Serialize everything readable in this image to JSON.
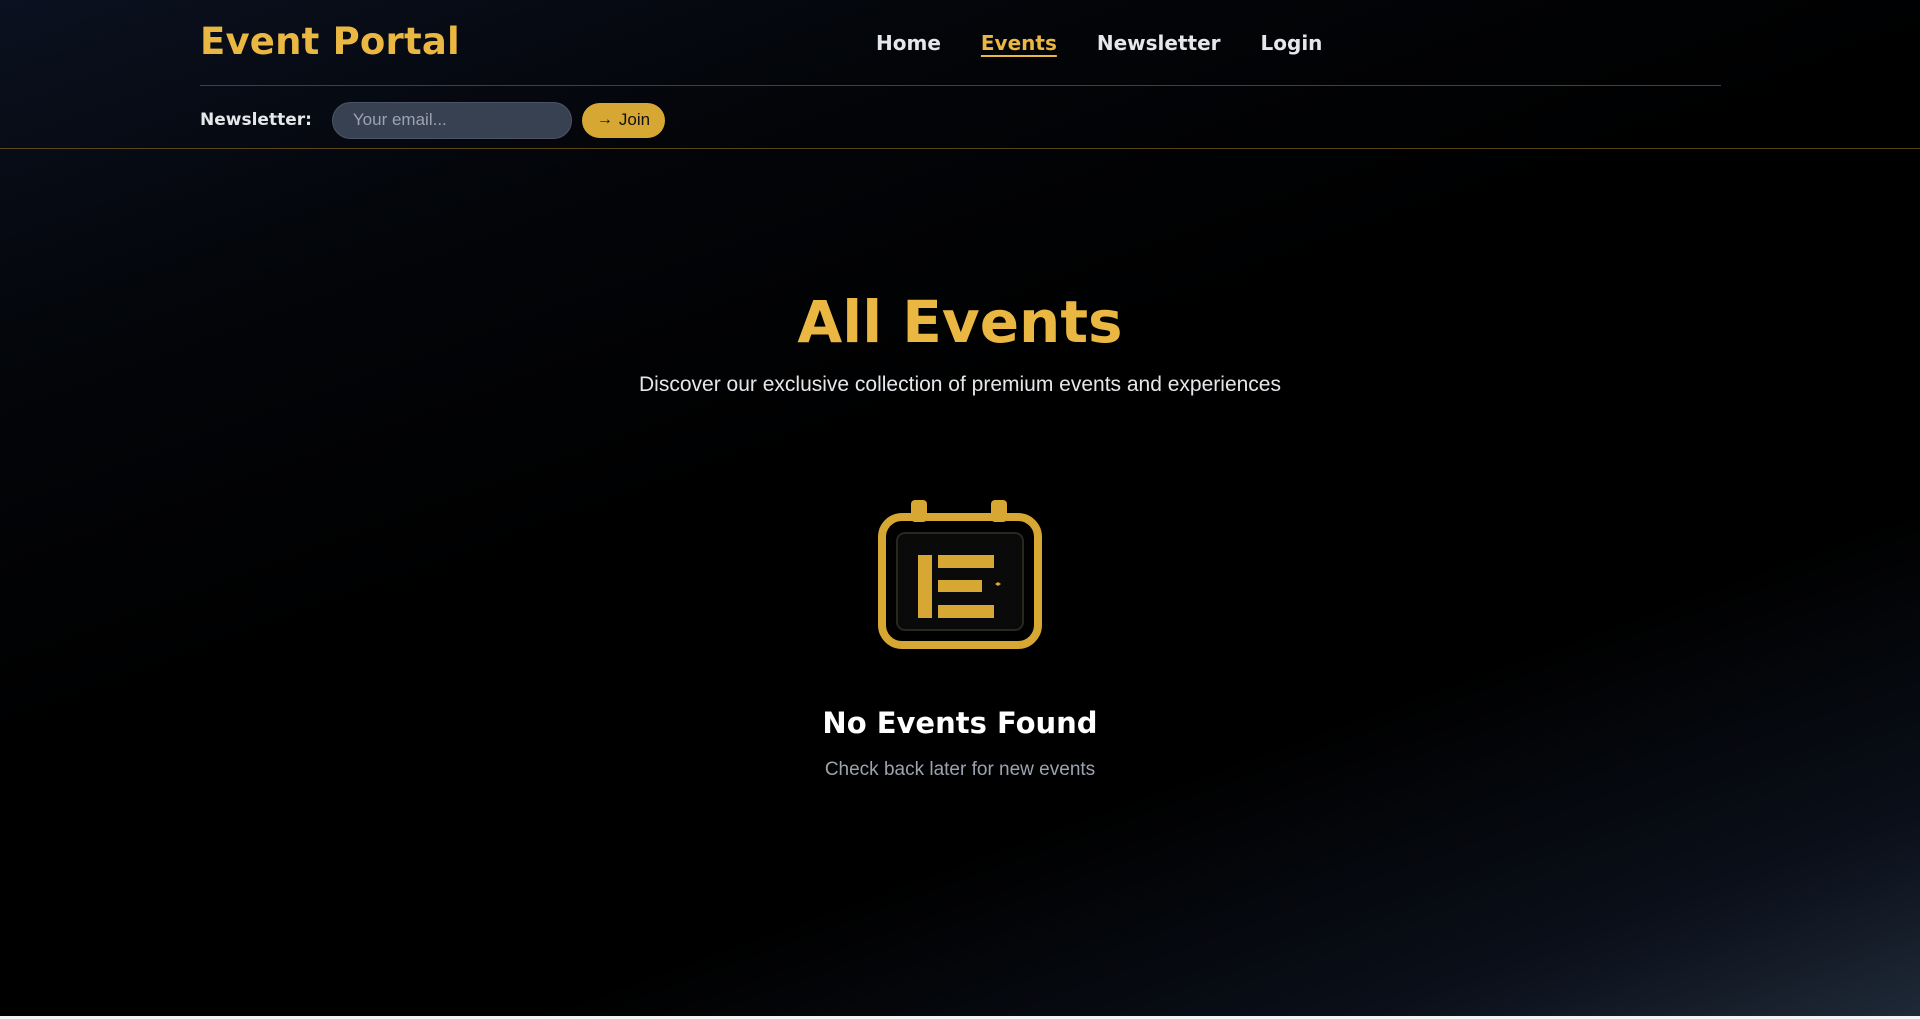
{
  "header": {
    "brand": "Event Portal",
    "nav": [
      {
        "label": "Home",
        "active": false
      },
      {
        "label": "Events",
        "active": true
      },
      {
        "label": "Newsletter",
        "active": false
      },
      {
        "label": "Login",
        "active": false
      }
    ],
    "newsletter": {
      "label": "Newsletter:",
      "placeholder": "Your email...",
      "value": "",
      "join_icon": "→",
      "join_label": "Join"
    }
  },
  "main": {
    "title": "All Events",
    "subtitle": "Discover our exclusive collection of premium events and experiences",
    "empty_state": {
      "icon": "calendar-icon",
      "title": "No Events Found",
      "text": "Check back later for new events"
    }
  },
  "colors": {
    "accent": "#eab842",
    "button": "#d6a732",
    "input_bg": "#374151",
    "background": "#000000",
    "muted_text": "#9ca3af"
  }
}
